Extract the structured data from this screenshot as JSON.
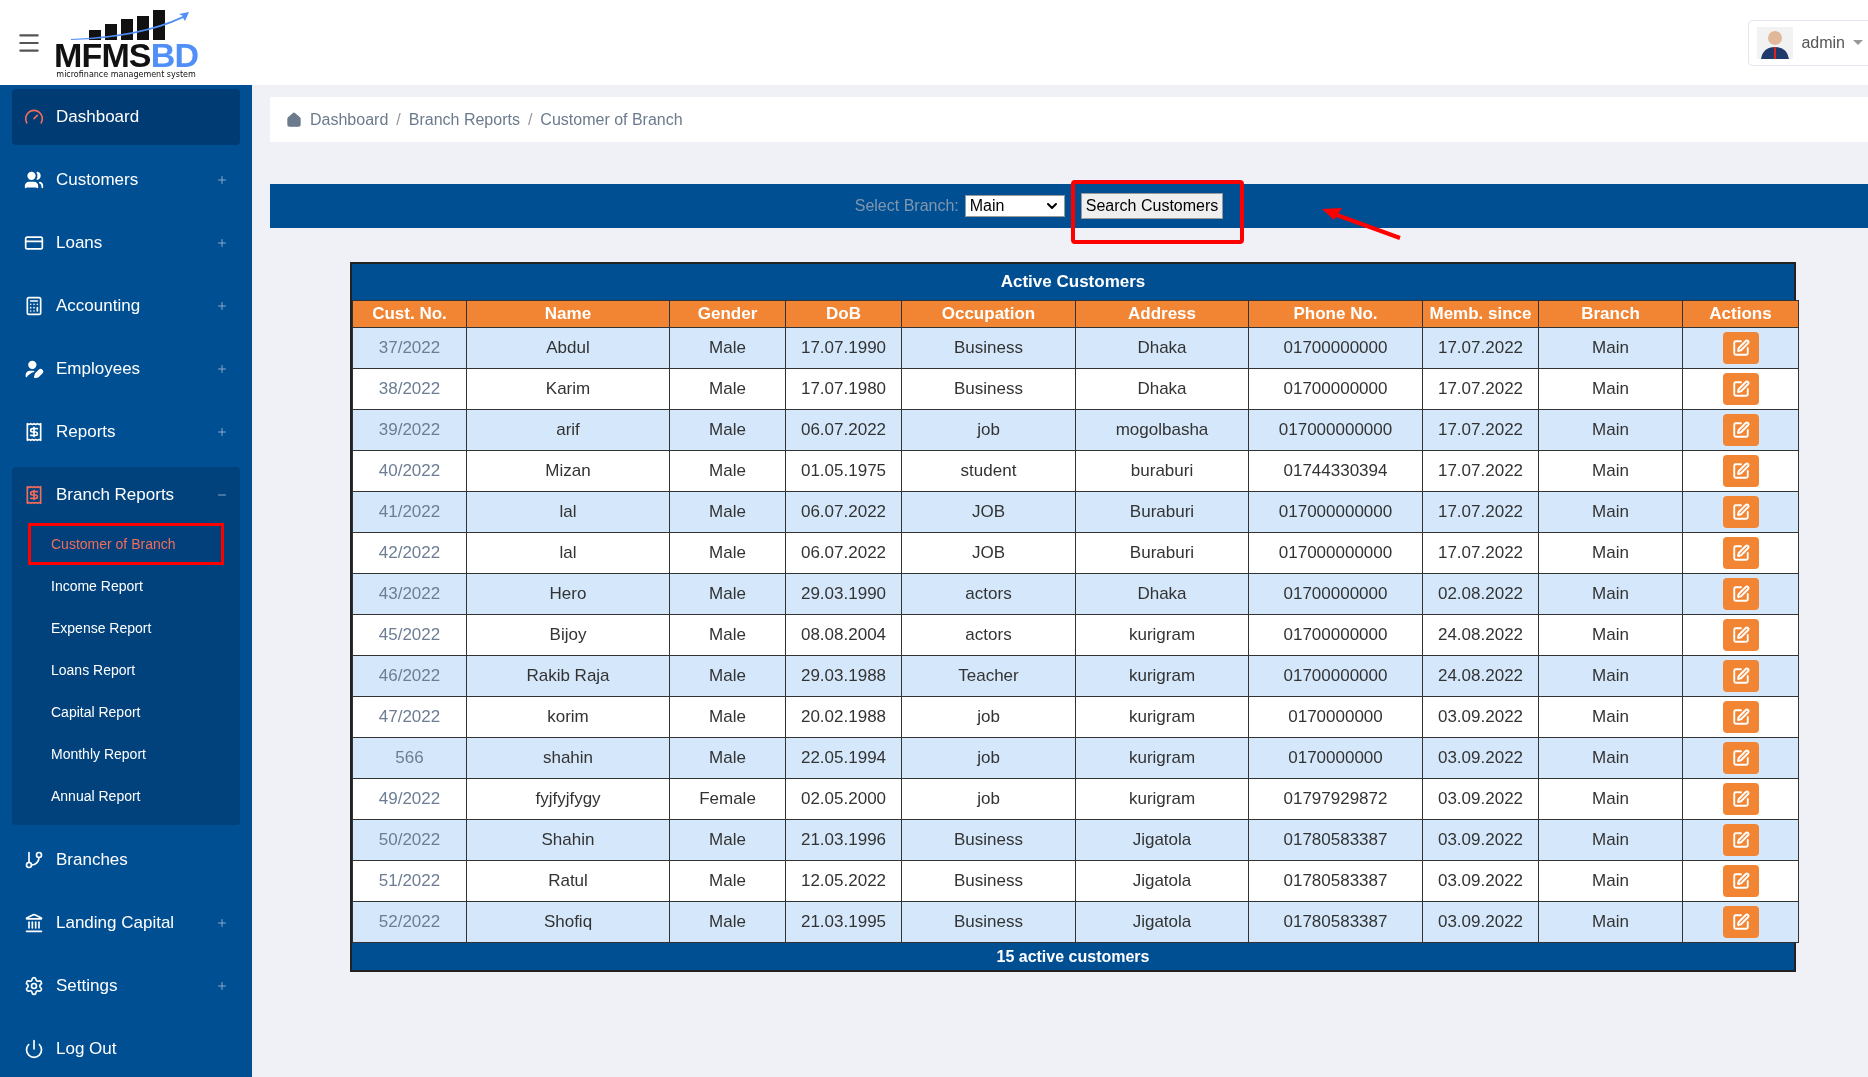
{
  "header": {
    "logo": {
      "title_dark": "MFMS",
      "title_light": "BD",
      "subtitle": "microfinance management system"
    },
    "user": {
      "name": "admin"
    }
  },
  "sidebar": {
    "items": [
      {
        "label": "Dashboard",
        "selected": true,
        "expandable": false,
        "expanded": false
      },
      {
        "label": "Customers",
        "selected": false,
        "expandable": true,
        "expanded": false
      },
      {
        "label": "Loans",
        "selected": false,
        "expandable": true,
        "expanded": false
      },
      {
        "label": "Accounting",
        "selected": false,
        "expandable": true,
        "expanded": false
      },
      {
        "label": "Employees",
        "selected": false,
        "expandable": true,
        "expanded": false
      },
      {
        "label": "Reports",
        "selected": false,
        "expandable": true,
        "expanded": false
      },
      {
        "label": "Branch Reports",
        "selected": false,
        "expandable": true,
        "expanded": true,
        "children": [
          {
            "label": "Customer of Branch",
            "selected": true,
            "annotated": true
          },
          {
            "label": "Income Report",
            "selected": false,
            "annotated": false
          },
          {
            "label": "Expense Report",
            "selected": false,
            "annotated": false
          },
          {
            "label": "Loans Report",
            "selected": false,
            "annotated": false
          },
          {
            "label": "Capital Report",
            "selected": false,
            "annotated": false
          },
          {
            "label": "Monthly Report",
            "selected": false,
            "annotated": false
          },
          {
            "label": "Annual Report",
            "selected": false,
            "annotated": false
          }
        ]
      },
      {
        "label": "Branches",
        "selected": false,
        "expandable": false,
        "expanded": false
      },
      {
        "label": "Landing Capital",
        "selected": false,
        "expandable": true,
        "expanded": false
      },
      {
        "label": "Settings",
        "selected": false,
        "expandable": true,
        "expanded": false
      },
      {
        "label": "Log Out",
        "selected": false,
        "expandable": false,
        "expanded": false
      }
    ]
  },
  "breadcrumb": {
    "separator": "/",
    "items": [
      "Dashboard",
      "Branch Reports",
      "Customer of Branch"
    ]
  },
  "filter": {
    "label": "Select Branch:",
    "branch": "Main",
    "button": "Search Customers",
    "annotated": true
  },
  "table": {
    "title": "Active Customers",
    "columns": [
      "Cust. No.",
      "Name",
      "Gender",
      "DoB",
      "Occupation",
      "Address",
      "Phone No.",
      "Memb. since",
      "Branch",
      "Actions"
    ],
    "rows": [
      [
        "37/2022",
        "Abdul",
        "Male",
        "17.07.1990",
        "Business",
        "Dhaka",
        "01700000000",
        "17.07.2022",
        "Main"
      ],
      [
        "38/2022",
        "Karim",
        "Male",
        "17.07.1980",
        "Business",
        "Dhaka",
        "01700000000",
        "17.07.2022",
        "Main"
      ],
      [
        "39/2022",
        "arif",
        "Male",
        "06.07.2022",
        "job",
        "mogolbasha",
        "017000000000",
        "17.07.2022",
        "Main"
      ],
      [
        "40/2022",
        "Mizan",
        "Male",
        "01.05.1975",
        "student",
        "buraburi",
        "01744330394",
        "17.07.2022",
        "Main"
      ],
      [
        "41/2022",
        "lal",
        "Male",
        "06.07.2022",
        "JOB",
        "Buraburi",
        "017000000000",
        "17.07.2022",
        "Main"
      ],
      [
        "42/2022",
        "lal",
        "Male",
        "06.07.2022",
        "JOB",
        "Buraburi",
        "017000000000",
        "17.07.2022",
        "Main"
      ],
      [
        "43/2022",
        "Hero",
        "Male",
        "29.03.1990",
        "actors",
        "Dhaka",
        "01700000000",
        "02.08.2022",
        "Main"
      ],
      [
        "45/2022",
        "Bijoy",
        "Male",
        "08.08.2004",
        "actors",
        "kurigram",
        "01700000000",
        "24.08.2022",
        "Main"
      ],
      [
        "46/2022",
        "Rakib Raja",
        "Male",
        "29.03.1988",
        "Teacher",
        "kurigram",
        "01700000000",
        "24.08.2022",
        "Main"
      ],
      [
        "47/2022",
        "korim",
        "Male",
        "20.02.1988",
        "job",
        "kurigram",
        "0170000000",
        "03.09.2022",
        "Main"
      ],
      [
        "566",
        "shahin",
        "Male",
        "22.05.1994",
        "job",
        "kurigram",
        "0170000000",
        "03.09.2022",
        "Main"
      ],
      [
        "49/2022",
        "fyjfyjfygy",
        "Female",
        "02.05.2000",
        "job",
        "kurigram",
        "01797929872",
        "03.09.2022",
        "Main"
      ],
      [
        "50/2022",
        "Shahin",
        "Male",
        "21.03.1996",
        "Business",
        "Jigatola",
        "01780583387",
        "03.09.2022",
        "Main"
      ],
      [
        "51/2022",
        "Ratul",
        "Male",
        "12.05.2022",
        "Business",
        "Jigatola",
        "01780583387",
        "03.09.2022",
        "Main"
      ],
      [
        "52/2022",
        "Shofiq",
        "Male",
        "21.03.1995",
        "Business",
        "Jigatola",
        "01780583387",
        "03.09.2022",
        "Main"
      ]
    ],
    "footer": "15 active customers"
  }
}
